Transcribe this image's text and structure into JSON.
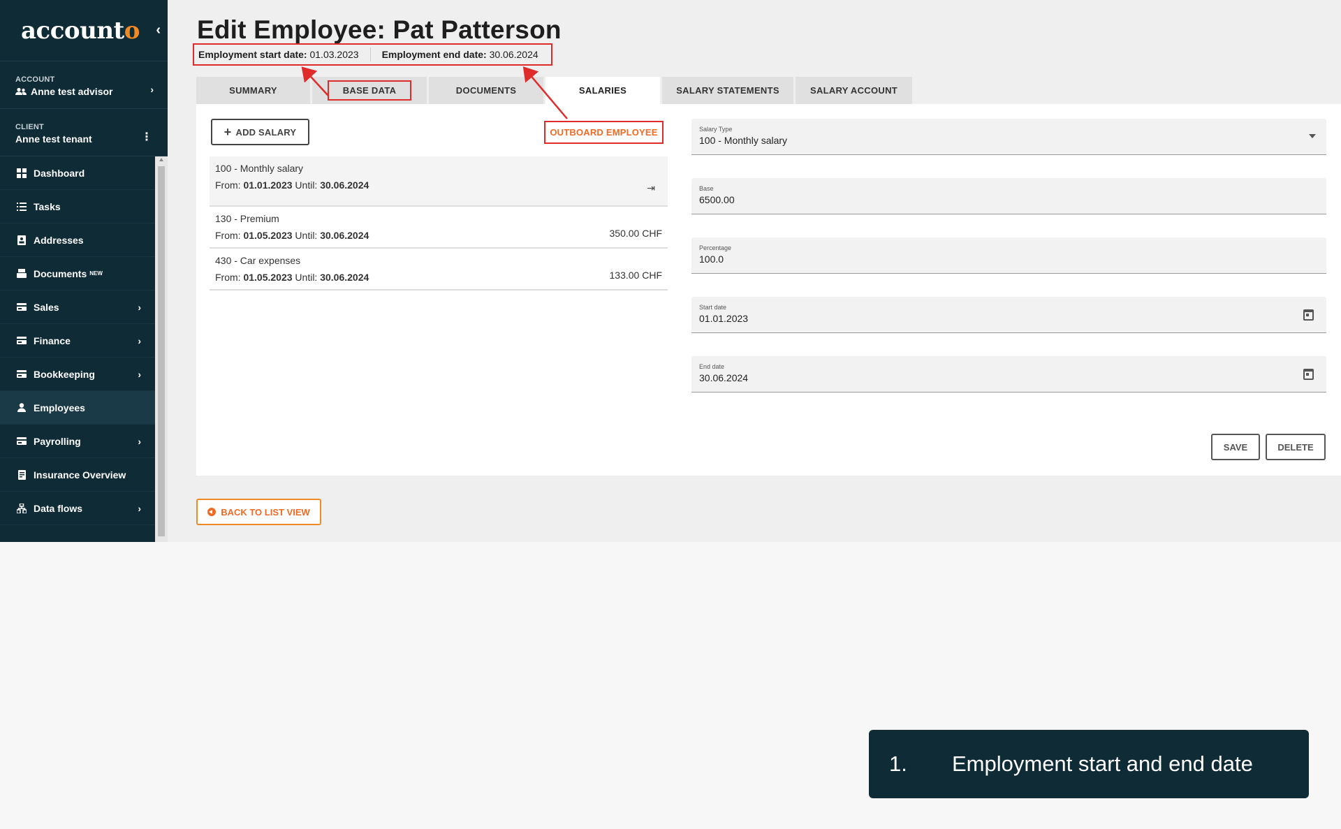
{
  "sidebar": {
    "logo_main": "account",
    "logo_accent": "o",
    "collapse_icon": "‹",
    "account": {
      "label": "ACCOUNT",
      "value": "Anne test advisor"
    },
    "client": {
      "label": "CLIENT",
      "value": "Anne test tenant"
    },
    "items": [
      {
        "label": "Dashboard",
        "icon": "dashboard-icon",
        "badge": "",
        "chevron": false,
        "active": false
      },
      {
        "label": "Tasks",
        "icon": "tasks-icon",
        "badge": "",
        "chevron": false,
        "active": false
      },
      {
        "label": "Addresses",
        "icon": "addresses-icon",
        "badge": "",
        "chevron": false,
        "active": false
      },
      {
        "label": "Documents",
        "icon": "documents-icon",
        "badge": "NEW",
        "chevron": false,
        "active": false
      },
      {
        "label": "Sales",
        "icon": "sales-icon",
        "badge": "",
        "chevron": true,
        "active": false
      },
      {
        "label": "Finance",
        "icon": "finance-icon",
        "badge": "",
        "chevron": true,
        "active": false
      },
      {
        "label": "Bookkeeping",
        "icon": "bookkeeping-icon",
        "badge": "",
        "chevron": true,
        "active": false
      },
      {
        "label": "Employees",
        "icon": "employees-icon",
        "badge": "",
        "chevron": false,
        "active": true
      },
      {
        "label": "Payrolling",
        "icon": "payrolling-icon",
        "badge": "",
        "chevron": true,
        "active": false
      },
      {
        "label": "Insurance Overview",
        "icon": "insurance-icon",
        "badge": "",
        "chevron": false,
        "active": false
      },
      {
        "label": "Data flows",
        "icon": "data-flows-icon",
        "badge": "",
        "chevron": true,
        "active": false
      }
    ]
  },
  "header": {
    "title": "Edit Employee: Pat Patterson",
    "start_label": "Employment start date:",
    "start_value": "01.03.2023",
    "end_label": "Employment end date:",
    "end_value": "30.06.2024"
  },
  "tabs": [
    {
      "label": "SUMMARY"
    },
    {
      "label": "BASE DATA"
    },
    {
      "label": "DOCUMENTS"
    },
    {
      "label": "SALARIES"
    },
    {
      "label": "SALARY STATEMENTS"
    },
    {
      "label": "SALARY ACCOUNT"
    }
  ],
  "salaries": {
    "add_label": "ADD SALARY",
    "outboard_label": "OUTBOARD EMPLOYEE",
    "from_label": "From:",
    "until_label": "Until:",
    "items": [
      {
        "name": "100 - Monthly salary",
        "from": "01.01.2023",
        "until": "30.06.2024",
        "amount": ""
      },
      {
        "name": "130 - Premium",
        "from": "01.05.2023",
        "until": "30.06.2024",
        "amount": "350.00 CHF"
      },
      {
        "name": "430 - Car expenses",
        "from": "01.05.2023",
        "until": "30.06.2024",
        "amount": "133.00 CHF"
      }
    ]
  },
  "form": {
    "salary_type": {
      "label": "Salary Type",
      "value": "100 - Monthly salary"
    },
    "base": {
      "label": "Base",
      "value": "6500.00"
    },
    "percentage": {
      "label": "Percentage",
      "value": "100.0"
    },
    "start_date": {
      "label": "Start date",
      "value": "01.01.2023"
    },
    "end_date": {
      "label": "End date",
      "value": "30.06.2024"
    },
    "save_label": "SAVE",
    "delete_label": "DELETE"
  },
  "back_label": "BACK TO LIST VIEW",
  "caption": {
    "number": "1.",
    "text": "Employment start and end date"
  },
  "colors": {
    "sidebar_bg": "#0f2b36",
    "accent": "#f06a24",
    "annotation": "#e02b2b"
  }
}
